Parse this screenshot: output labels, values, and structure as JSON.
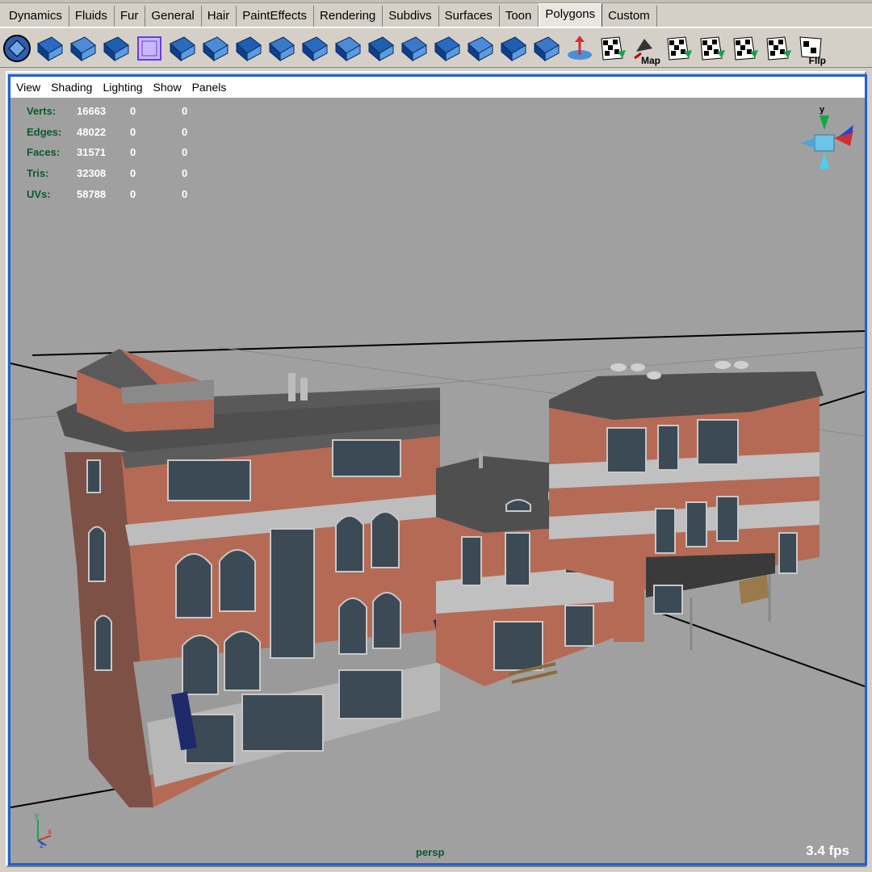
{
  "shelf_tabs": [
    "Dynamics",
    "Fluids",
    "Fur",
    "General",
    "Hair",
    "PaintEffects",
    "Rendering",
    "Subdivs",
    "Surfaces",
    "Toon",
    "Polygons",
    "Custom"
  ],
  "active_tab": "Polygons",
  "shelf_tools": [
    {
      "icon": "sphere-select-icon"
    },
    {
      "icon": "poly-cubes-icon"
    },
    {
      "icon": "poly-sphere-split-icon"
    },
    {
      "icon": "poly-smooth-sphere-icon"
    },
    {
      "icon": "poly-wire-cube-icon"
    },
    {
      "icon": "poly-plane-icon"
    },
    {
      "icon": "poly-select-arrow-icon"
    },
    {
      "icon": "poly-extrude-icon"
    },
    {
      "icon": "poly-bevel-icon"
    },
    {
      "icon": "poly-face-icon"
    },
    {
      "icon": "poly-slab-icon"
    },
    {
      "icon": "poly-split-icon"
    },
    {
      "icon": "poly-wedge-icon"
    },
    {
      "icon": "poly-append-icon"
    },
    {
      "icon": "poly-merge-icon"
    },
    {
      "icon": "poly-combine-icon"
    },
    {
      "icon": "poly-tile-icon"
    },
    {
      "icon": "poly-pivot-icon"
    },
    {
      "icon": "checker-map-icon"
    },
    {
      "icon": "map-uv-icon",
      "label": "Map"
    },
    {
      "icon": "checker-warp-icon"
    },
    {
      "icon": "checker-sphere-icon"
    },
    {
      "icon": "checker-t-icon"
    },
    {
      "icon": "checker-select-icon"
    },
    {
      "icon": "flip-uv-icon",
      "label": "Flip"
    }
  ],
  "panel_menu": [
    "View",
    "Shading",
    "Lighting",
    "Show",
    "Panels"
  ],
  "hud": [
    {
      "label": "Verts:",
      "total": "16663",
      "selected": "0",
      "other": "0"
    },
    {
      "label": "Edges:",
      "total": "48022",
      "selected": "0",
      "other": "0"
    },
    {
      "label": "Faces:",
      "total": "31571",
      "selected": "0",
      "other": "0"
    },
    {
      "label": "Tris:",
      "total": "32308",
      "selected": "0",
      "other": "0"
    },
    {
      "label": "UVs:",
      "total": "58788",
      "selected": "0",
      "other": "0"
    }
  ],
  "camera": "persp",
  "fps": "3.4 fps",
  "viewcube_axis": "y",
  "colors": {
    "viewport_bg": "#a0a0a0",
    "hud_label": "#0b5a2a",
    "active_border": "#1f5fd6",
    "brick": "#b56a55"
  }
}
